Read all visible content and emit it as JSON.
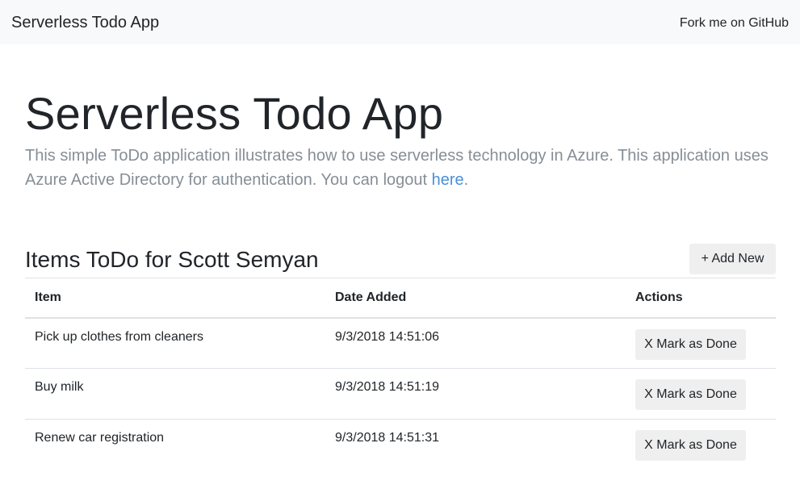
{
  "navbar": {
    "brand": "Serverless Todo App",
    "fork_link": "Fork me on GitHub"
  },
  "jumbotron": {
    "title": "Serverless Todo App",
    "lead_text": "This simple ToDo application illustrates how to use serverless technology in Azure. This application uses Azure Active Directory for authentication. You can logout ",
    "logout_link": "here",
    "lead_end": "."
  },
  "section": {
    "title": "Items ToDo for Scott Semyan",
    "add_button": "+ Add New"
  },
  "table": {
    "headers": [
      "Item",
      "Date Added",
      "Actions"
    ],
    "rows": [
      {
        "item": "Pick up clothes from cleaners",
        "date": "9/3/2018 14:51:06",
        "action": "X Mark as Done"
      },
      {
        "item": "Buy milk",
        "date": "9/3/2018 14:51:19",
        "action": "X Mark as Done"
      },
      {
        "item": "Renew car registration",
        "date": "9/3/2018 14:51:31",
        "action": "X Mark as Done"
      }
    ]
  },
  "colors": {
    "navbar_bg": "#f8f9fa",
    "link": "#4a90d9",
    "lead_text": "#868e96",
    "button_bg": "#efefef"
  }
}
